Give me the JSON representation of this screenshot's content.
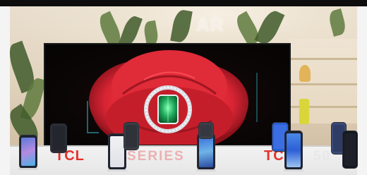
{
  "scene": {
    "sign_text": "AR",
    "counter_brand_1": "TCL",
    "counter_text_1": "SERIES",
    "counter_brand_2": "TCL",
    "counter_text_2": "50"
  },
  "colors": {
    "brand_red": "#e5312a",
    "rose_red": "#d72433",
    "emerald": "#1fa65a",
    "phone_blue": "#2c5fd6"
  }
}
